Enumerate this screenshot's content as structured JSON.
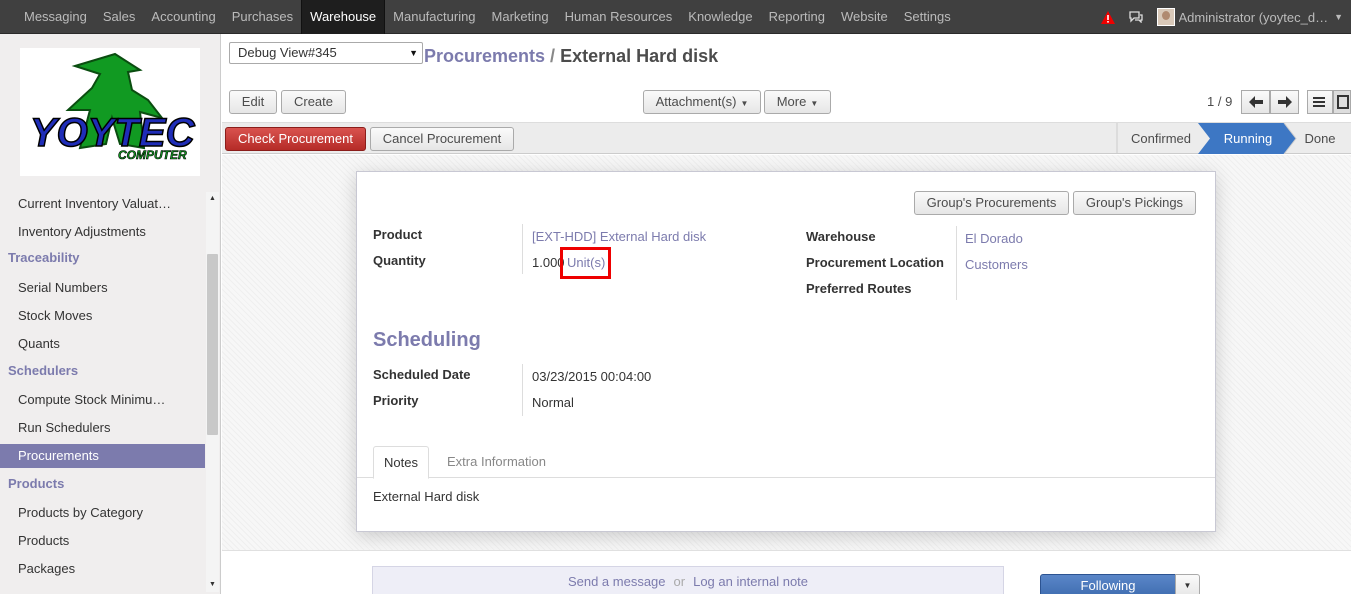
{
  "topbar": {
    "menu": [
      "Messaging",
      "Sales",
      "Accounting",
      "Purchases",
      "Warehouse",
      "Manufacturing",
      "Marketing",
      "Human Resources",
      "Knowledge",
      "Reporting",
      "Website",
      "Settings"
    ],
    "active_menu": "Warehouse",
    "user": "Administrator (yoytec_d…",
    "icons": [
      "warning-icon",
      "chat-icon",
      "avatar"
    ]
  },
  "sidebar": {
    "logo_text": "YOYTEC",
    "logo_subtext": "COMPUTER",
    "items": [
      {
        "type": "item",
        "label": "Current Inventory Valuat…"
      },
      {
        "type": "item",
        "label": "Inventory Adjustments"
      },
      {
        "type": "head",
        "label": "Traceability"
      },
      {
        "type": "item",
        "label": "Serial Numbers"
      },
      {
        "type": "item",
        "label": "Stock Moves"
      },
      {
        "type": "item",
        "label": "Quants"
      },
      {
        "type": "head",
        "label": "Schedulers"
      },
      {
        "type": "item",
        "label": "Compute Stock Minimu…"
      },
      {
        "type": "item",
        "label": "Run Schedulers"
      },
      {
        "type": "item",
        "label": "Procurements",
        "active": true
      },
      {
        "type": "head",
        "label": "Products"
      },
      {
        "type": "item",
        "label": "Products by Category"
      },
      {
        "type": "item",
        "label": "Products"
      },
      {
        "type": "item",
        "label": "Packages"
      }
    ]
  },
  "control": {
    "debug_select": "Debug View#345",
    "breadcrumb_parent": "Procurements",
    "breadcrumb_sep": "/",
    "breadcrumb_current": "External Hard disk",
    "edit": "Edit",
    "create": "Create",
    "attachments": "Attachment(s)",
    "more": "More",
    "pager": "1 / 9"
  },
  "statusbar": {
    "check": "Check Procurement",
    "cancel": "Cancel Procurement",
    "steps": [
      "Confirmed",
      "Running",
      "Done"
    ],
    "active_step": "Running"
  },
  "form": {
    "groups_procurements": "Group's Procurements",
    "groups_pickings": "Group's Pickings",
    "product_label": "Product",
    "product_value": "[EXT-HDD] External Hard disk",
    "quantity_label": "Quantity",
    "quantity_value": "1.000",
    "uom": "Unit(s)",
    "warehouse_label": "Warehouse",
    "warehouse_value": "El Dorado",
    "location_label": "Procurement Location",
    "location_value": "Customers",
    "routes_label": "Preferred Routes",
    "scheduling": "Scheduling",
    "date_label": "Scheduled Date",
    "date_value": "03/23/2015 00:04:00",
    "priority_label": "Priority",
    "priority_value": "Normal",
    "tab_notes": "Notes",
    "tab_extra": "Extra Information",
    "notes": "External Hard disk"
  },
  "chatter": {
    "send": "Send a message",
    "or": "or",
    "log": "Log an internal note",
    "following": "Following"
  },
  "colors": {
    "accent": "#7c7bad",
    "topbar": "#404040",
    "danger": "#c9302c",
    "step_active": "#3d77c4",
    "highlight": "#e00000"
  }
}
